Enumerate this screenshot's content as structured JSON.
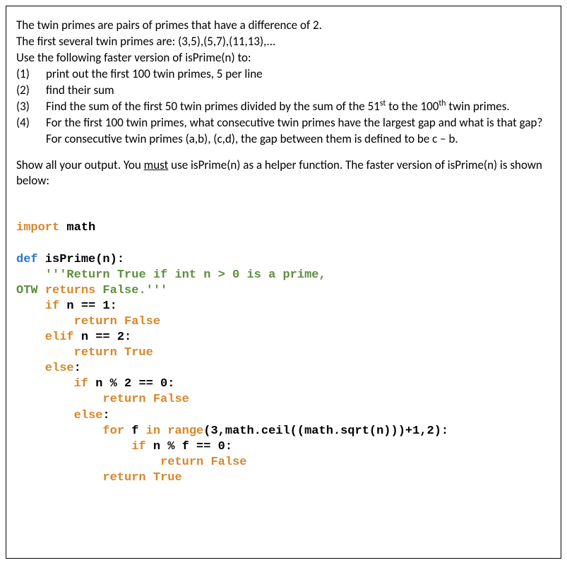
{
  "intro": {
    "line1": "The twin primes are pairs of primes that have a difference of 2.",
    "line2": "The first several twin primes are:  (3,5),(5,7),(11,13),...",
    "line3": "Use the following faster version of isPrime(n) to:"
  },
  "items": [
    {
      "num": "(1)",
      "text": "print out the first 100 twin primes, 5 per line"
    },
    {
      "num": "(2)",
      "text": " find their sum"
    },
    {
      "num": "(3)",
      "text_before": "Find the sum of the first 50 twin primes divided by the sum of the 51",
      "sup1": "st",
      "text_mid": " to the 100",
      "sup2": "th",
      "text_after": " twin primes."
    },
    {
      "num": "(4)",
      "text": "For the first 100 twin primes, what consecutive twin primes have the largest gap and what is that gap?  For consecutive twin primes (a,b), (c,d), the gap between them  is defined to be c – b."
    }
  ],
  "instructions": {
    "before": "Show all your output.  You ",
    "underlined": "must",
    "after": " use isPrime(n) as a helper function.  The faster version of isPrime(n) is shown below:"
  },
  "code": {
    "import_kw": "import",
    "math_mod": " math",
    "def_kw": "def",
    "func_sig": " isPrime(n):",
    "docstring_open": "    '''",
    "docstring_text1": "Return True if int n > 0 is a prime,",
    "otw": "OTW ",
    "returns_kw": "returns",
    "docstring_text2": " False.'''",
    "if1": "    if",
    "cond1": " n == 1:",
    "ret1_kw": "        return",
    "false1": " False",
    "elif_kw": "    elif",
    "cond2": " n == 2:",
    "ret2_kw": "        return",
    "true1": " True",
    "else1_kw": "    else",
    "colon1": ":",
    "if2": "        if",
    "cond3": " n % 2 == 0:",
    "ret3_kw": "            return",
    "false2": " False",
    "else2_kw": "        else",
    "colon2": ":",
    "for_kw": "            for",
    "for_var": " f ",
    "in_kw": "in",
    "space1": " ",
    "range_kw": "range",
    "range_args": "(3,math.ceil((math.sqrt(n)))+1,2):",
    "if3": "                if",
    "cond4": " n % f == 0:",
    "ret4_kw": "                    return",
    "false3": " False",
    "ret5_kw": "            return",
    "true2": " True"
  }
}
